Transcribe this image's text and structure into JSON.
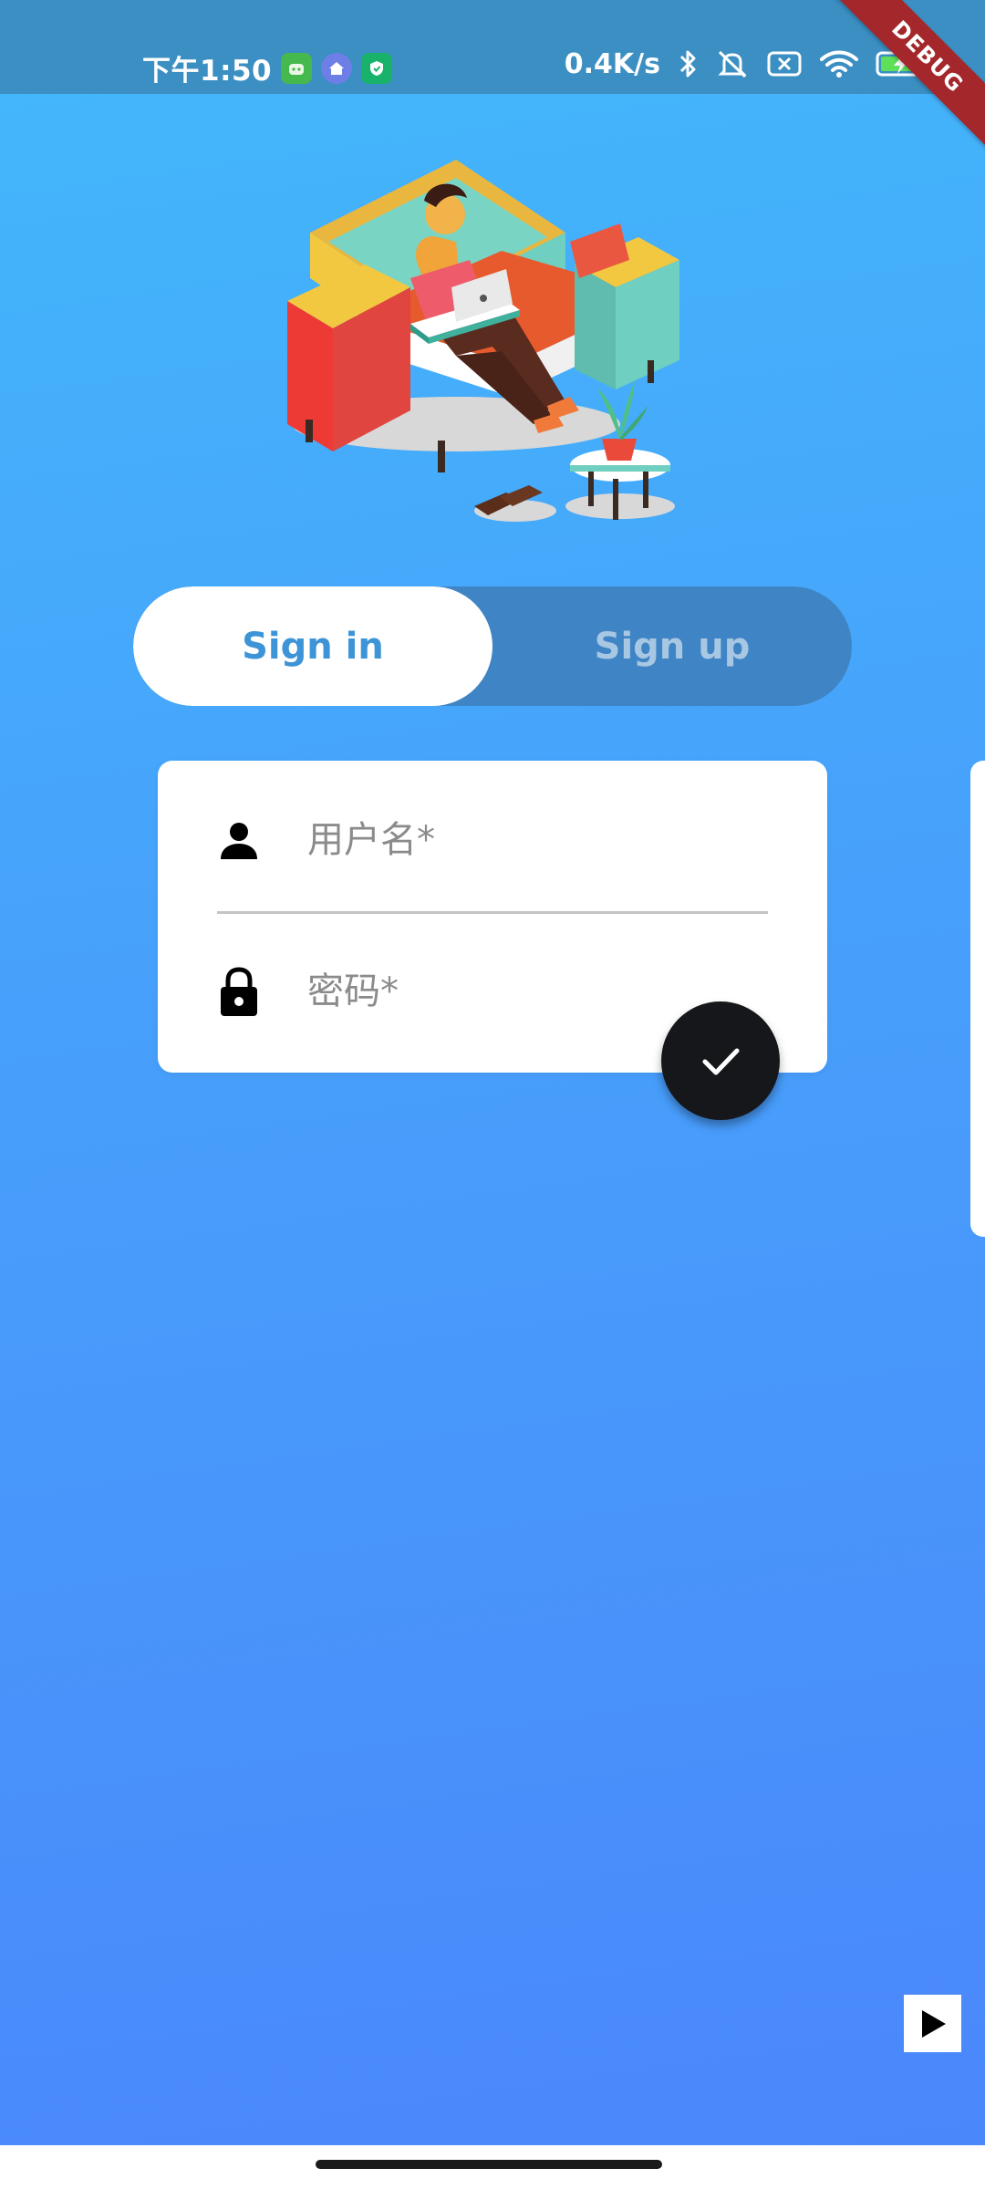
{
  "status_bar": {
    "time": "下午1:50",
    "net_speed": "0.4K/s",
    "debug_label": "DEBUG",
    "app_icons": [
      "android-notification-icon",
      "home-app-icon",
      "shield-app-icon"
    ],
    "right_icons": [
      "bluetooth-icon",
      "mute-icon",
      "no-sim-icon",
      "wifi-icon",
      "battery-charging-icon"
    ]
  },
  "illustration": {
    "icon": "person-on-sofa-illustration"
  },
  "auth_toggle": {
    "sign_in": "Sign in",
    "sign_up": "Sign up",
    "selected": "Sign in"
  },
  "form": {
    "username": {
      "placeholder": "用户名*",
      "value": "",
      "icon": "person-icon"
    },
    "password": {
      "placeholder": "密码*",
      "value": "",
      "icon": "lock-icon"
    }
  },
  "submit": {
    "icon": "check-icon"
  },
  "media": {
    "icon": "play-icon"
  },
  "colors": {
    "accent": "#3d94d6",
    "toggle_bg": "#3f84c4",
    "fab": "#15171b",
    "gradient_top": "#43b8fb",
    "gradient_bottom": "#4a86fb",
    "status_bar": "#3b8fc2",
    "debug_ribbon": "#a3272b"
  }
}
